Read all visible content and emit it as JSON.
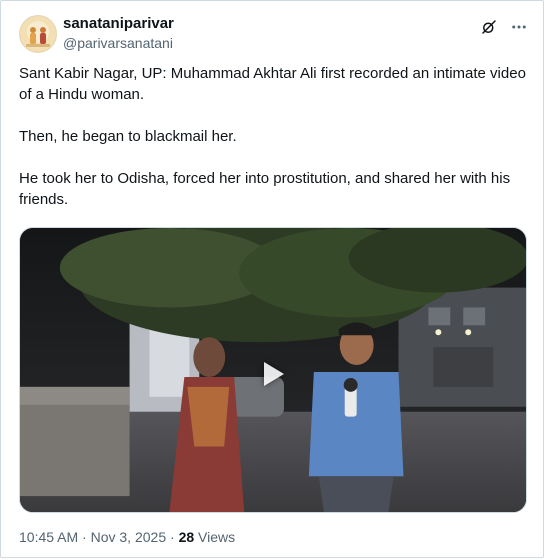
{
  "author": {
    "display_name": "sanataniparivar",
    "handle": "@parivarsanatani"
  },
  "tweet": {
    "text": "Sant Kabir Nagar, UP: Muhammad Akhtar Ali first recorded an intimate video of a Hindu woman.\n\nThen, he began to blackmail her.\n\nHe took her to Odisha, forced her into prostitution, and shared her with his friends."
  },
  "meta": {
    "time": "10:45 AM",
    "separator_1": " · ",
    "date": "Nov 3, 2025",
    "separator_2": " · ",
    "views_count": "28",
    "views_label": " Views"
  },
  "icons": {
    "grok": "grok-icon",
    "more": "more-icon",
    "play": "play-icon"
  },
  "colors": {
    "text": "#0f1419",
    "secondary": "#536471",
    "border": "#cfd9de"
  }
}
